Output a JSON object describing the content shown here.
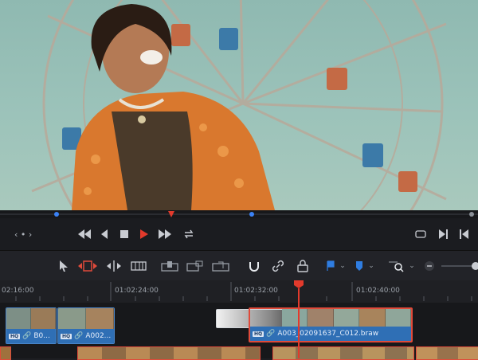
{
  "viewer": {
    "image": "video-frame-woman-laughing-ferris-wheel"
  },
  "scrubber": {
    "playhead_color": "#e23a2c",
    "marker_color": "#3b82f6"
  },
  "transport": {
    "nav_left": "‹ • ›",
    "icons": [
      "skip-back-icon",
      "step-back-icon",
      "stop-icon",
      "play-icon",
      "skip-forward-icon",
      "loop-icon"
    ],
    "right_icons": [
      "fit-icon",
      "mark-in-icon",
      "mark-out-icon"
    ]
  },
  "toolbar": {
    "tools": [
      "pointer-icon",
      "trim-icon",
      "dynamic-trim-icon",
      "blade-icon",
      "insert-icon",
      "overwrite-icon",
      "replace-icon",
      "snapping-icon",
      "linked-selection-icon",
      "lock-icon",
      "flag-icon",
      "marker-icon",
      "zoom-icon",
      "zoom-out-icon"
    ]
  },
  "ruler": {
    "timecodes": [
      "02:16:00",
      "01:02:24:00",
      "01:02:32:00",
      "01:02:40:00"
    ]
  },
  "tracks": {
    "v2_clips": [
      {
        "label": "B0..."
      },
      {
        "label": "A002..."
      },
      {
        "label": "A003_02091637_C012.braw"
      }
    ],
    "hq_badge": "HQ"
  },
  "colors": {
    "clip_blue": "#2f6fb5",
    "selected_red": "#e04a3a",
    "playhead": "#e23a2c"
  }
}
